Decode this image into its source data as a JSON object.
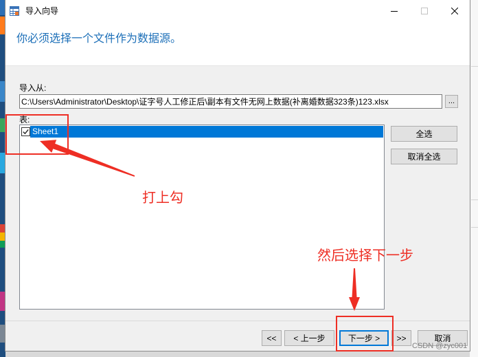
{
  "window": {
    "title": "导入向导",
    "app_icon": "table-grid-icon",
    "controls": {
      "minimize": "minimize-icon",
      "maximize": "maximize-icon",
      "close": "close-icon"
    }
  },
  "header": {
    "heading": "你必须选择一个文件作为数据源。"
  },
  "source": {
    "label": "导入从:",
    "path": "C:\\Users\\Administrator\\Desktop\\证字号人工修正后\\副本有文件无网上数据(补离婚数据323条)123.xlsx",
    "browse_label": "..."
  },
  "tables": {
    "label": "表:",
    "items": [
      {
        "name": "Sheet1",
        "checked": true,
        "selected": true
      }
    ]
  },
  "list_actions": {
    "select_all": "全选",
    "deselect_all": "取消全选"
  },
  "footer": {
    "first": "<<",
    "back": "< 上一步",
    "next": "下一步 >",
    "last": ">>",
    "cancel": "取消"
  },
  "annotations": {
    "check_hint": "打上勾",
    "next_hint": "然后选择下一步",
    "arrow_icon": "red-arrow-icon"
  },
  "watermark": "CSDN @zyc001",
  "colors": {
    "heading": "#1c6fb8",
    "selection": "#0078d7",
    "annotation": "#ee2e24",
    "dialog_bg": "#f0f0f0"
  }
}
